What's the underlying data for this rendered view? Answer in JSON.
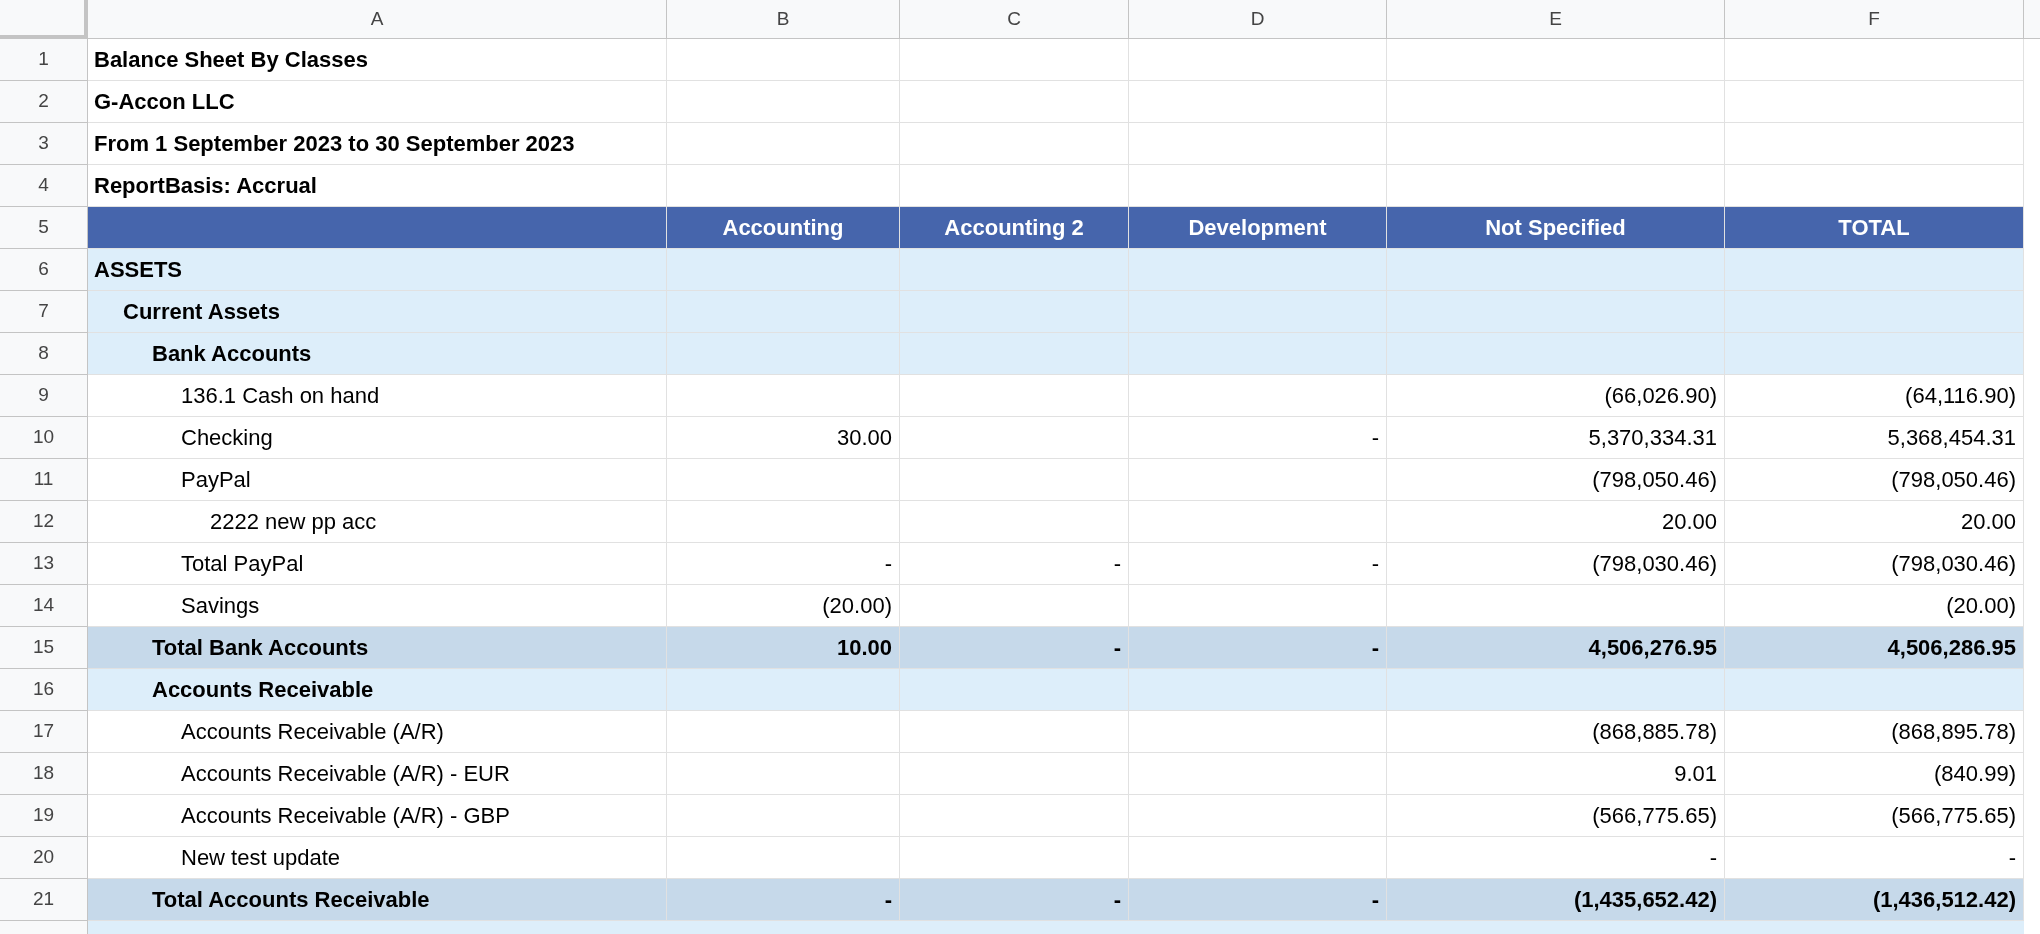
{
  "column_letters": [
    "A",
    "B",
    "C",
    "D",
    "E",
    "F"
  ],
  "rows": [
    {
      "row_number": "1",
      "kind": "title",
      "label": "Balance Sheet By Classes"
    },
    {
      "row_number": "2",
      "kind": "title",
      "label": "G-Accon LLC"
    },
    {
      "row_number": "3",
      "kind": "title",
      "label": "From 1 September 2023 to 30 September 2023"
    },
    {
      "row_number": "4",
      "kind": "title",
      "label": "ReportBasis: Accrual"
    },
    {
      "row_number": "5",
      "kind": "header",
      "cells": [
        "Accounting",
        "Accounting 2",
        "Development",
        "Not Specified",
        "TOTAL"
      ]
    },
    {
      "row_number": "6",
      "kind": "section",
      "label": "ASSETS",
      "children": [
        {
          "row_number": "7",
          "kind": "section",
          "label": "Current Assets",
          "children": [
            {
              "row_number": "8",
              "kind": "section",
              "label": "Bank Accounts",
              "children": [
                {
                  "row_number": "9",
                  "kind": "line",
                  "label": "136.1 Cash on hand",
                  "cells": [
                    null,
                    null,
                    null,
                    "(66,026.90)",
                    "(64,116.90)"
                  ]
                },
                {
                  "row_number": "10",
                  "kind": "line",
                  "label": "Checking",
                  "cells": [
                    "30.00",
                    null,
                    "-",
                    "5,370,334.31",
                    "5,368,454.31"
                  ]
                },
                {
                  "row_number": "11",
                  "kind": "line",
                  "label": "PayPal",
                  "cells": [
                    null,
                    null,
                    null,
                    "(798,050.46)",
                    "(798,050.46)"
                  ],
                  "children": [
                    {
                      "row_number": "12",
                      "kind": "line",
                      "label": "2222 new pp acc",
                      "cells": [
                        null,
                        null,
                        null,
                        "20.00",
                        "20.00"
                      ]
                    }
                  ]
                },
                {
                  "row_number": "13",
                  "kind": "line",
                  "label": "Total PayPal",
                  "cells": [
                    "-",
                    "-",
                    "-",
                    "(798,030.46)",
                    "(798,030.46)"
                  ]
                },
                {
                  "row_number": "14",
                  "kind": "line",
                  "label": "Savings",
                  "cells": [
                    "(20.00)",
                    null,
                    null,
                    null,
                    "(20.00)"
                  ]
                }
              ]
            },
            {
              "row_number": "15",
              "kind": "total",
              "label": "Total Bank Accounts",
              "cells": [
                "10.00",
                "-",
                "-",
                "4,506,276.95",
                "4,506,286.95"
              ]
            },
            {
              "row_number": "16",
              "kind": "section",
              "label": "Accounts Receivable",
              "children": [
                {
                  "row_number": "17",
                  "kind": "line",
                  "label": "Accounts Receivable (A/R)",
                  "cells": [
                    null,
                    null,
                    null,
                    "(868,885.78)",
                    "(868,895.78)"
                  ]
                },
                {
                  "row_number": "18",
                  "kind": "line",
                  "label": "Accounts Receivable (A/R) - EUR",
                  "cells": [
                    null,
                    null,
                    null,
                    "9.01",
                    "(840.99)"
                  ]
                },
                {
                  "row_number": "19",
                  "kind": "line",
                  "label": "Accounts Receivable (A/R) - GBP",
                  "cells": [
                    null,
                    null,
                    null,
                    "(566,775.65)",
                    "(566,775.65)"
                  ]
                },
                {
                  "row_number": "20",
                  "kind": "line",
                  "label": "New test update",
                  "cells": [
                    null,
                    null,
                    null,
                    "-",
                    "-"
                  ]
                }
              ]
            },
            {
              "row_number": "21",
              "kind": "total",
              "label": "Total Accounts Receivable",
              "cells": [
                "-",
                "-",
                "-",
                "(1,435,652.42)",
                "(1,436,512.42)"
              ]
            }
          ]
        }
      ]
    }
  ]
}
